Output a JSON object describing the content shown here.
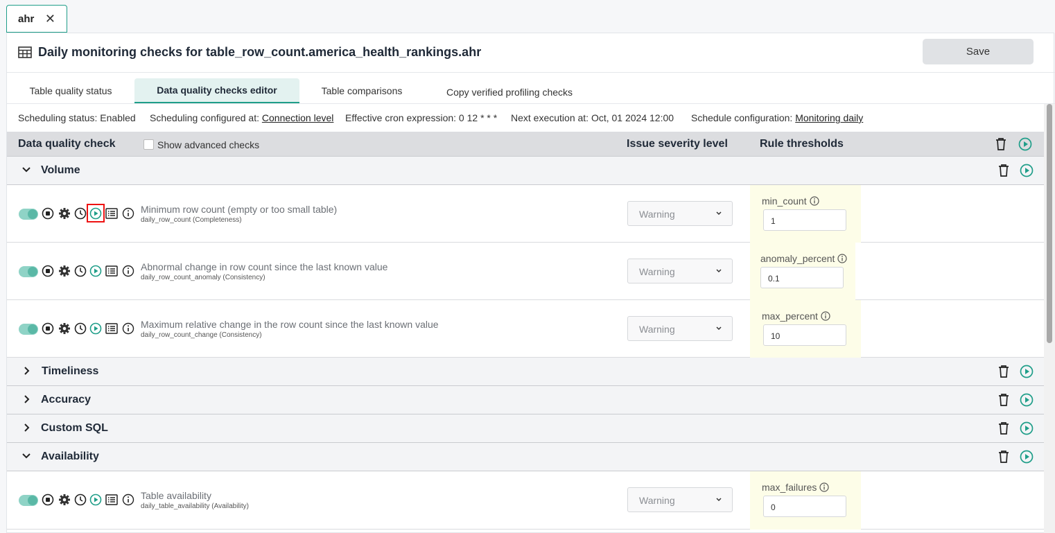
{
  "file_tab": {
    "label": "ahr",
    "close_symbol": "✕"
  },
  "header": {
    "title": "Daily monitoring checks for table_row_count.america_health_rankings.ahr",
    "save_label": "Save"
  },
  "subtabs": [
    {
      "label": "Table quality status"
    },
    {
      "label": "Data quality checks editor"
    },
    {
      "label": "Table comparisons"
    },
    {
      "label": "Copy verified profiling checks"
    }
  ],
  "schedule": {
    "status": "Scheduling status: Enabled",
    "configured_prefix": "Scheduling configured at:",
    "configured_link": "Connection level",
    "cron": "Effective cron expression: 0 12 * * *",
    "next": "Next execution at: Oct, 01 2024 12:00",
    "config_prefix": "Schedule configuration:",
    "config_link": "Monitoring daily"
  },
  "table_header": {
    "check": "Data quality check",
    "show_advanced": "Show advanced checks",
    "severity": "Issue severity level",
    "thresholds": "Rule thresholds"
  },
  "groups": {
    "volume": "Volume",
    "timeliness": "Timeliness",
    "accuracy": "Accuracy",
    "custom_sql": "Custom SQL",
    "availability": "Availability"
  },
  "checks": [
    {
      "name": "Minimum row count (empty or too small table)",
      "sub": "daily_row_count (Completeness)",
      "severity": "Warning",
      "rule_label": "min_count",
      "rule_value": "1"
    },
    {
      "name": "Abnormal change in row count since the last known value",
      "sub": "daily_row_count_anomaly (Consistency)",
      "severity": "Warning",
      "rule_label": "anomaly_percent",
      "rule_value": "0.1"
    },
    {
      "name": "Maximum relative change in the row count since the last known value",
      "sub": "daily_row_count_change (Consistency)",
      "severity": "Warning",
      "rule_label": "max_percent",
      "rule_value": "10"
    },
    {
      "name": "Table availability",
      "sub": "daily_table_availability (Availability)",
      "severity": "Warning",
      "rule_label": "max_failures",
      "rule_value": "0"
    }
  ],
  "colors": {
    "accent": "#1f9e89",
    "toggle": "#8fd3c6",
    "highlight": "#ee1111",
    "rule_bg": "#fdfde8"
  }
}
